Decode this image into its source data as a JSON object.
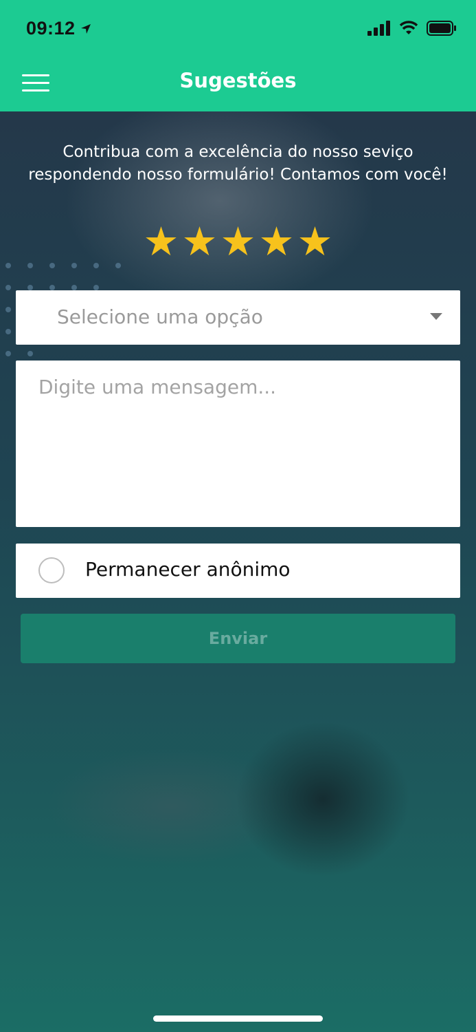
{
  "status_bar": {
    "time": "09:12"
  },
  "header": {
    "title": "Sugestões"
  },
  "intro_text": "Contribua com a excelência do nosso seviço respondendo nosso formulário! Contamos com você!",
  "rating": {
    "value": 5,
    "max": 5,
    "star_color": "#f7c21c"
  },
  "form": {
    "select_placeholder": "Selecione uma opção",
    "message_placeholder": "Digite uma mensagem...",
    "anonymous_label": "Permanecer anônimo",
    "anonymous_checked": false,
    "submit_label": "Enviar"
  },
  "colors": {
    "accent": "#1ccb92",
    "button": "#1a7f6c"
  }
}
